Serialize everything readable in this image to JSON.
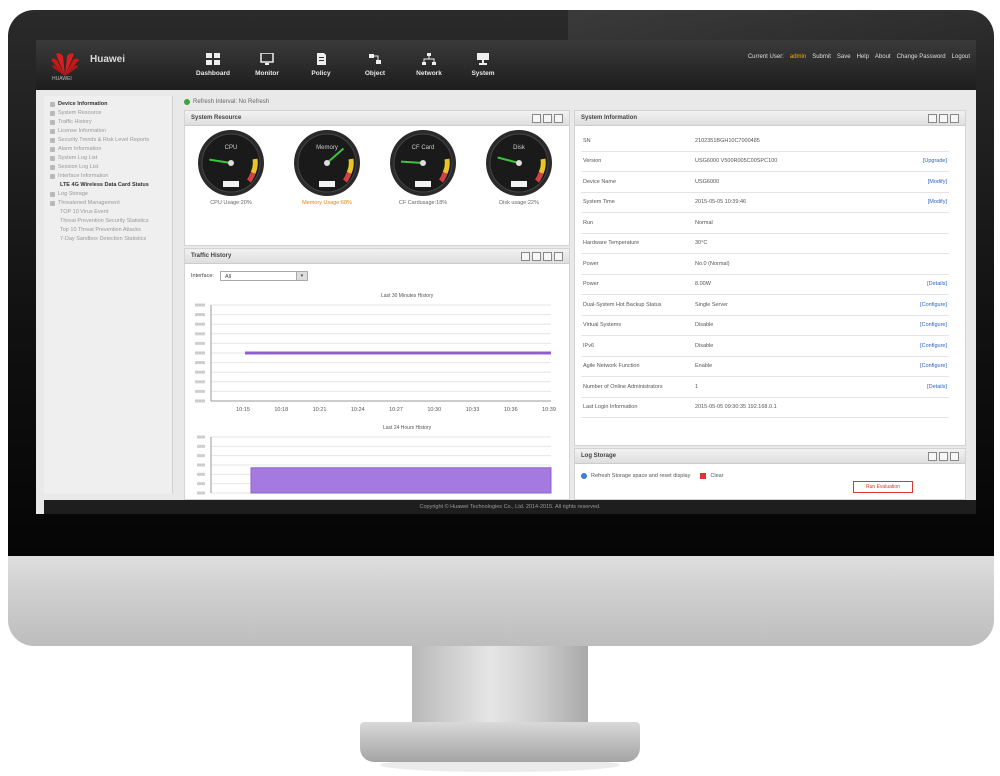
{
  "app": {
    "brand": "Huawei",
    "logo_sub": "HUAWEI"
  },
  "nav": [
    {
      "label": "Dashboard",
      "icon": "dashboard-icon"
    },
    {
      "label": "Monitor",
      "icon": "monitor-icon"
    },
    {
      "label": "Policy",
      "icon": "policy-icon"
    },
    {
      "label": "Object",
      "icon": "object-icon"
    },
    {
      "label": "Network",
      "icon": "network-icon"
    },
    {
      "label": "System",
      "icon": "system-icon"
    }
  ],
  "user_bar": {
    "current_user_label": "Current User:",
    "user": "admin",
    "links": [
      "Submit",
      "Save",
      "Help",
      "About",
      "Change Password",
      "Logout"
    ]
  },
  "sidebar": {
    "items": [
      {
        "label": "Device Information",
        "active": true
      },
      {
        "label": "System Resource"
      },
      {
        "label": "Traffic History"
      },
      {
        "label": "License Information"
      },
      {
        "label": "Security Trends & Risk Level Reports"
      },
      {
        "label": "Alarm Information"
      },
      {
        "label": "System Log List"
      },
      {
        "label": "Session Log List"
      },
      {
        "label": "Interface Information"
      },
      {
        "label": "LTE 4G Wireless Data Card Status",
        "active": true,
        "sub": true
      },
      {
        "label": "Log Storage"
      },
      {
        "label": "Threatened Management"
      },
      {
        "label": "TOP 10 Virus Event",
        "sub": true
      },
      {
        "label": "Threat Prevention Security Statistics",
        "sub": true
      },
      {
        "label": "Top 10 Threat Prevention Attacks",
        "sub": true
      },
      {
        "label": "7-Day Sandbox Detection Statistics",
        "sub": true
      }
    ]
  },
  "refresh": {
    "label": "Refresh Interval: No Refresh"
  },
  "system_resource": {
    "title": "System Resource",
    "gauges": [
      {
        "name": "CPU",
        "label": "CPU Usage:20%",
        "value": 20,
        "warn": false
      },
      {
        "name": "Memory",
        "label": "Memory Usage:68%",
        "value": 68,
        "warn": true
      },
      {
        "name": "CF Card",
        "label": "CF Cardusage:18%",
        "value": 18,
        "warn": false
      },
      {
        "name": "Disk",
        "label": "Disk usage:22%",
        "value": 22,
        "warn": false
      }
    ]
  },
  "traffic_history": {
    "title": "Traffic History",
    "interface_label": "Interface:",
    "interface_value": "All",
    "chart1_title": "Last 30 Minutes History",
    "chart2_title": "Last 24 Hours History",
    "time_ticks": [
      "10:15",
      "10:18",
      "10:21",
      "10:24",
      "10:27",
      "10:30",
      "10:33",
      "10:36",
      "10:39"
    ]
  },
  "chart_data": [
    {
      "type": "line",
      "title": "Last 30 Minutes History",
      "x": [
        "10:15",
        "10:18",
        "10:21",
        "10:24",
        "10:27",
        "10:30",
        "10:33",
        "10:36",
        "10:39"
      ],
      "series": [
        {
          "values": [
            0.5,
            0.5,
            0.5,
            0.5,
            0.5,
            0.5,
            0.5,
            0.5,
            0.5
          ],
          "color": "#8f5fcf"
        }
      ],
      "ylim": [
        0,
        1
      ]
    },
    {
      "type": "area",
      "title": "Last 24 Hours History",
      "series": [
        {
          "values": [
            0.45,
            0.45,
            0.45,
            0.45
          ],
          "color": "#a57ae0"
        }
      ],
      "ylim": [
        0,
        1
      ]
    }
  ],
  "system_info": {
    "title": "System Information",
    "rows": [
      {
        "key": "SN",
        "value": "2102351BGH10C7000485",
        "action": ""
      },
      {
        "key": "Version",
        "value": "USG6000 V500R005C00SPC100",
        "action": "[Upgrade]"
      },
      {
        "key": "Device Name",
        "value": "USG6000",
        "action": "[Modify]"
      },
      {
        "key": "System Time",
        "value": "2015-05-05 10:39:46",
        "action": "[Modify]"
      },
      {
        "key": "Run",
        "value": "Normal",
        "action": ""
      },
      {
        "key": "Hardware Temperature",
        "value": "30°C",
        "action": ""
      },
      {
        "key": "Power",
        "value": "No.0 (Normal)",
        "action": ""
      },
      {
        "key": "Power",
        "value": "8.00W",
        "action": "[Details]"
      },
      {
        "key": "Dual-System Hot Backup Status",
        "value": "Single Server",
        "action": "[Configure]"
      },
      {
        "key": "Virtual Systems",
        "value": "Disable",
        "action": "[Configure]"
      },
      {
        "key": "IPv6",
        "value": "Disable",
        "action": "[Configure]"
      },
      {
        "key": "Agile Network Function",
        "value": "Enable",
        "action": "[Configure]"
      },
      {
        "key": "Number of Online Administrators",
        "value": "1",
        "action": "[Details]"
      },
      {
        "key": "Last Login Information",
        "value": "2015-05-05 09:30:35 192.168.0.1",
        "action": ""
      }
    ]
  },
  "log_storage": {
    "title": "Log Storage",
    "refresh_text": "Refresh Storage space and reset display",
    "clear_label": "Clear",
    "button_label": "Run Evaluation"
  },
  "footer": {
    "text": "Copyright © Huawei Technologies Co., Ltd. 2014-2015. All rights reserved."
  },
  "colors": {
    "accent_purple": "#8f5fcf",
    "link_blue": "#2b63c6",
    "warn_orange": "#e08a00",
    "topbar": "#262626"
  }
}
